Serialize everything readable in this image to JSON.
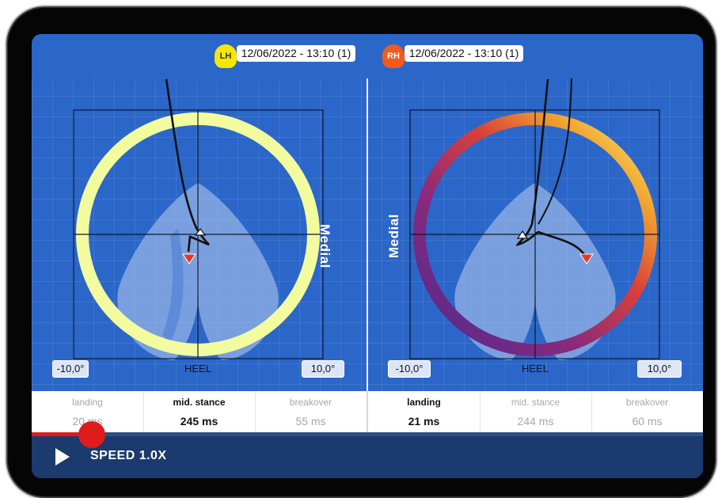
{
  "left_panel": {
    "badge": "LH",
    "session_label": "12/06/2022 - 13:10 (1)",
    "axis_min": "-10,0°",
    "axis_max": "10,0°",
    "heel_label": "HEEL",
    "side_label": "Medial"
  },
  "right_panel": {
    "badge": "RH",
    "session_label": "12/06/2022 - 13:10 (1)",
    "axis_min": "-10,0°",
    "axis_max": "10,0°",
    "heel_label": "HEEL",
    "side_label": "Medial"
  },
  "metrics": [
    {
      "label": "landing",
      "value": "20 ms",
      "active": false
    },
    {
      "label": "mid. stance",
      "value": "245 ms",
      "active": true
    },
    {
      "label": "breakover",
      "value": "55 ms",
      "active": false
    },
    {
      "label": "landing",
      "value": "21 ms",
      "active": true
    },
    {
      "label": "mid. stance",
      "value": "244 ms",
      "active": false
    },
    {
      "label": "breakover",
      "value": "60 ms",
      "active": false
    }
  ],
  "player": {
    "speed_label": "SPEED 1.0X",
    "progress": 0.09
  },
  "colors": {
    "screen_bg": "#2b66c9",
    "left_ring": "#f3fb9f",
    "right_ring_start": "#4b2a8f",
    "right_ring_mid": "#d8403a",
    "right_ring_end": "#f5d13d",
    "lh_badge": "#f6e700",
    "rh_badge": "#f25a1d",
    "progress": "#e01b1b",
    "player_bg": "#1b3a6d"
  }
}
